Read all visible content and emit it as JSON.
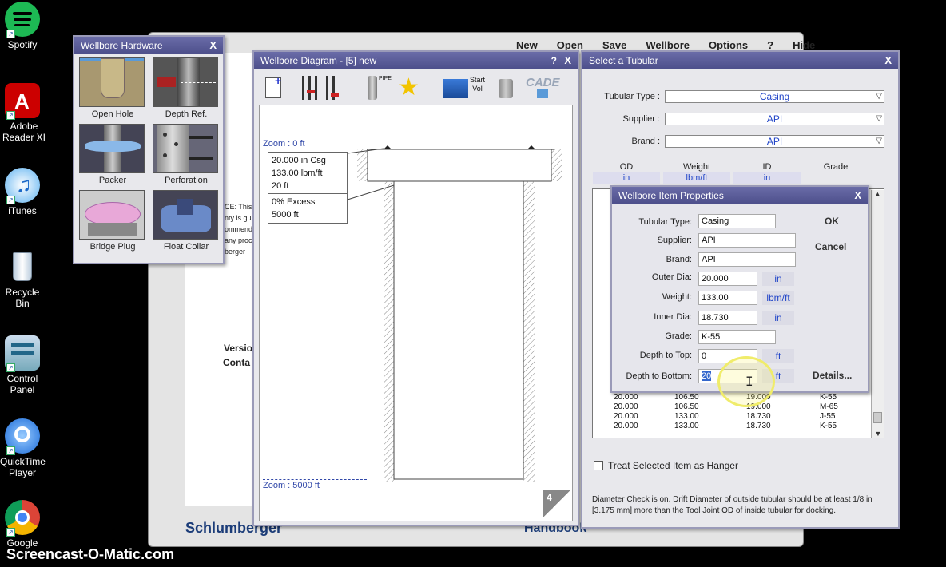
{
  "desktop": {
    "icons": [
      {
        "label": "Spotify"
      },
      {
        "label": "Adobe Reader XI"
      },
      {
        "label": "iTunes"
      },
      {
        "label": "Recycle Bin"
      },
      {
        "label": "Control Panel"
      },
      {
        "label": "QuickTime Player"
      },
      {
        "label": "Google"
      }
    ],
    "watermark": "Screencast-O-Matic.com"
  },
  "back_window": {
    "menu": [
      "New",
      "Open",
      "Save",
      "Wellbore",
      "Options",
      "?",
      "Hide"
    ],
    "notice_lines": [
      "CE: This",
      "nty is gu",
      "ommend",
      "any proc",
      "berger"
    ],
    "version_label": "Versio",
    "contact_label": "Conta",
    "brand": "Schlumberger",
    "handbook": "Handbook"
  },
  "hardware": {
    "title": "Wellbore Hardware",
    "close": "X",
    "items": [
      {
        "label": "Open Hole"
      },
      {
        "label": "Depth Ref."
      },
      {
        "label": "Packer"
      },
      {
        "label": "Perforation"
      },
      {
        "label": "Bridge Plug"
      },
      {
        "label": "Float Collar"
      }
    ]
  },
  "diagram": {
    "title": "Wellbore Diagram - [5] new",
    "help": "?",
    "close": "X",
    "tools": {
      "pipe": "PIPE",
      "start": "Start",
      "vol": "Vol",
      "cade": "CADE"
    },
    "zoom_top": "Zoom : 0 ft",
    "zoom_bottom": "Zoom : 5000 ft",
    "callout1": [
      "20.000 in  Csg",
      "133.00 lbm/ft",
      "20 ft"
    ],
    "callout2": [
      "0% Excess",
      "5000 ft"
    ],
    "page_num": "4"
  },
  "tubular": {
    "title": "Select a Tubular",
    "close": "X",
    "type_label": "Tubular Type :",
    "type_value": "Casing",
    "supplier_label": "Supplier :",
    "supplier_value": "API",
    "brand_label": "Brand :",
    "brand_value": "API",
    "columns": [
      "OD",
      "Weight",
      "ID",
      "Grade"
    ],
    "units": [
      "in",
      "lbm/ft",
      "in"
    ],
    "rows": [
      [
        "20.000",
        "106.50",
        "19.000",
        "K-55"
      ],
      [
        "20.000",
        "106.50",
        "19.000",
        "M-65"
      ],
      [
        "20.000",
        "133.00",
        "18.730",
        "J-55"
      ],
      [
        "20.000",
        "133.00",
        "18.730",
        "K-55"
      ]
    ],
    "hanger_label": "Treat Selected Item as Hanger",
    "note": "Diameter Check is on.  Drift Diameter of outside tubular should be at least 1/8 in [3.175 mm] more than the Tool Joint OD of inside tubular for docking."
  },
  "properties": {
    "title": "Wellbore Item Properties",
    "close": "X",
    "ok": "OK",
    "cancel": "Cancel",
    "details": "Details...",
    "fields": {
      "type_label": "Tubular Type:",
      "type_value": "Casing",
      "supplier_label": "Supplier:",
      "supplier_value": "API",
      "brand_label": "Brand:",
      "brand_value": "API",
      "od_label": "Outer Dia:",
      "od_value": "20.000",
      "od_unit": "in",
      "wt_label": "Weight:",
      "wt_value": "133.00",
      "wt_unit": "lbm/ft",
      "id_label": "Inner Dia:",
      "id_value": "18.730",
      "id_unit": "in",
      "grade_label": "Grade:",
      "grade_value": "K-55",
      "top_label": "Depth to Top:",
      "top_value": "0",
      "top_unit": "ft",
      "bottom_label": "Depth to Bottom:",
      "bottom_value": "20",
      "bottom_unit": "ft"
    }
  }
}
